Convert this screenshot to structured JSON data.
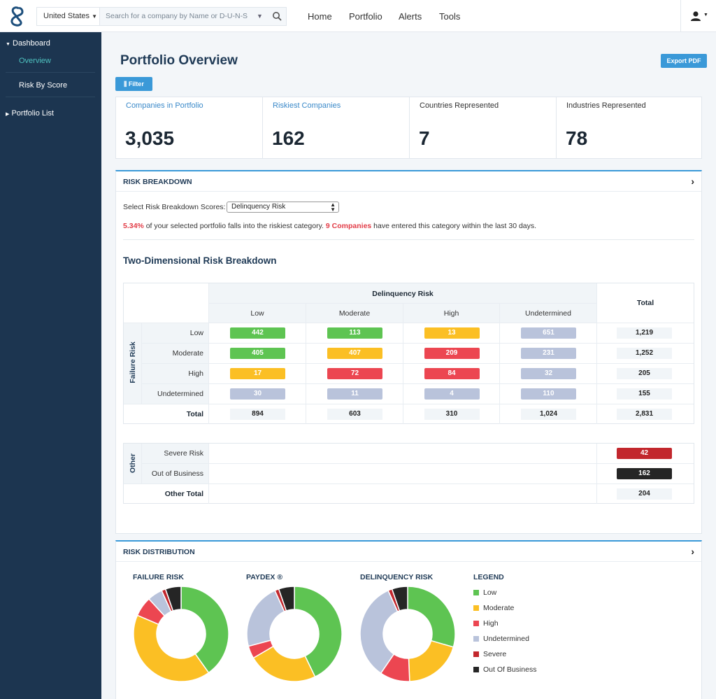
{
  "header": {
    "country_select": "United States",
    "search_placeholder": "Search for a company by Name or D-U-N-S",
    "nav": [
      "Home",
      "Portfolio",
      "Alerts",
      "Tools"
    ]
  },
  "sidebar": {
    "items": [
      {
        "label": "Dashboard",
        "expanded": true
      },
      {
        "label": "Overview",
        "active": true
      },
      {
        "label": "Risk By Score"
      },
      {
        "label": "Portfolio List",
        "expanded": false
      }
    ]
  },
  "page": {
    "title": "Portfolio Overview",
    "filter_label": "Filter",
    "export_label": "Export PDF"
  },
  "cards": [
    {
      "label": "Companies in Portfolio",
      "value": "3,035"
    },
    {
      "label": "Riskiest Companies",
      "value": "162"
    },
    {
      "label": "Countries Represented",
      "value": "7"
    },
    {
      "label": "Industries Represented",
      "value": "78"
    }
  ],
  "risk_breakdown": {
    "header": "RISK BREAKDOWN",
    "select_label": "Select Risk Breakdown Scores:",
    "select_value": "Delinquency Risk",
    "summary_pct": "5.34%",
    "summary_mid": " of your selected portfolio falls into the riskiest category. ",
    "summary_companies": "9 Companies",
    "summary_end": " have entered this category within the last 30 days.",
    "section_title": "Two-Dimensional Risk Breakdown",
    "col_group": "Delinquency Risk",
    "row_group": "Failure Risk",
    "total_label": "Total",
    "columns": [
      "Low",
      "Moderate",
      "High",
      "Undetermined"
    ],
    "rows": [
      {
        "label": "Low",
        "cells": [
          "442",
          "113",
          "13",
          "651"
        ],
        "colors": [
          "green",
          "green",
          "yellow",
          "gray"
        ],
        "total": "1,219"
      },
      {
        "label": "Moderate",
        "cells": [
          "405",
          "407",
          "209",
          "231"
        ],
        "colors": [
          "green",
          "yellow",
          "red",
          "gray"
        ],
        "total": "1,252"
      },
      {
        "label": "High",
        "cells": [
          "17",
          "72",
          "84",
          "32"
        ],
        "colors": [
          "yellow",
          "red",
          "red",
          "gray"
        ],
        "total": "205"
      },
      {
        "label": "Undetermined",
        "cells": [
          "30",
          "11",
          "4",
          "110"
        ],
        "colors": [
          "gray",
          "gray",
          "gray",
          "gray"
        ],
        "total": "155"
      }
    ],
    "totals_row": {
      "label": "Total",
      "cells": [
        "894",
        "603",
        "310",
        "1,024"
      ],
      "total": "2,831"
    },
    "other": {
      "group_label": "Other",
      "rows": [
        {
          "label": "Severe Risk",
          "value": "42",
          "color": "#c2272d"
        },
        {
          "label": "Out of Business",
          "value": "162",
          "color": "#252525"
        }
      ],
      "total_label": "Other Total",
      "total": "204"
    }
  },
  "colors": {
    "green": "#5ec452",
    "yellow": "#fbbf24",
    "red": "#ec4651",
    "gray": "#b9c3db",
    "severe": "#c2272d",
    "oob": "#252525",
    "accent": "#3a99d8"
  },
  "risk_distribution": {
    "header": "RISK DISTRIBUTION",
    "legend_title": "LEGEND"
  },
  "chart_data": [
    {
      "type": "pie",
      "title": "FAILURE RISK",
      "categories": [
        "Low",
        "Moderate",
        "High",
        "Undetermined",
        "Severe",
        "Out Of Business"
      ],
      "values": [
        1219,
        1252,
        205,
        155,
        42,
        162
      ]
    },
    {
      "type": "pie",
      "title": "PAYDEX ®",
      "categories": [
        "Low",
        "Moderate",
        "High",
        "Undetermined",
        "Severe",
        "Out Of Business"
      ],
      "values": [
        1300,
        720,
        130,
        681,
        42,
        162
      ]
    },
    {
      "type": "pie",
      "title": "DELINQUENCY RISK",
      "categories": [
        "Low",
        "Moderate",
        "High",
        "Undetermined",
        "Severe",
        "Out Of Business"
      ],
      "values": [
        894,
        603,
        310,
        1024,
        42,
        162
      ]
    }
  ],
  "legend": [
    "Low",
    "Moderate",
    "High",
    "Undetermined",
    "Severe",
    "Out Of Business"
  ]
}
